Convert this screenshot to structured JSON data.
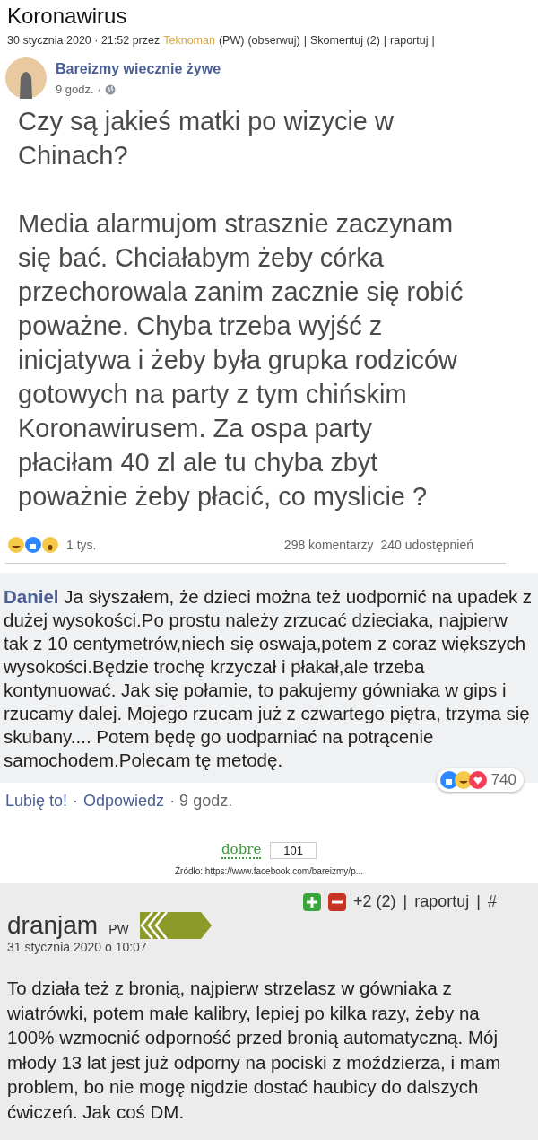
{
  "article": {
    "title": "Koronawirus",
    "date": "30 stycznia 2020 · 21:52 przez",
    "author": "Teknoman",
    "rank": "(PW)",
    "follow": "(obserwuj)",
    "sep1": "|",
    "comment_link": "Skomentuj (2)",
    "sep2": "|",
    "report": "raportuj",
    "sep3": "|"
  },
  "fb_post": {
    "page_name": "Bareizmy wiecznie żywe",
    "time": "9 godz. ·",
    "paragraphs": [
      "Czy są jakieś matki po wizycie w Chinach?",
      "Media alarmujom strasznie zaczynam się bać. Chciałabym żeby córka przechorowala zanim zacznie się robić poważne. Chyba trzeba wyjść z inicjatywa i żeby była grupka rodziców gotowych na party z tym chińskim Koronawirusem. Za ospa party płaciłam 40 zl ale tu chyba zbyt poważnie żeby płacić, co myslicie ?"
    ],
    "reactions_count": "1 tys.",
    "comments_count": "298 komentarzy",
    "shares_count": "240 udostępnień"
  },
  "fb_comment": {
    "author": "Daniel",
    "text": "Ja słyszałem, że dzieci można też uodpornić na upadek z dużej wysokości.Po prostu należy zrzucać dzieciaka, najpierw tak z 10 centymetrów,niech się oswaja,potem z coraz większych wysokości.Będzie trochę krzyczał i płakał,ale trzeba kontynuować. Jak się połamie, to pakujemy gówniaka w gips i rzucamy dalej. Mojego rzucam już z czwartego piętra, trzyma się skubany.... Potem będę go uodparniać na potrącenie samochodem.Polecam tę metodę.",
    "reactions_count": "740",
    "like": "Lubię to!",
    "reply": "Odpowiedz",
    "time": "· 9 godz.",
    "dot": "·"
  },
  "vote": {
    "label": "dobre",
    "count": "101"
  },
  "source": "Źródło: https://www.facebook.com/bareizmy/p...",
  "comment": {
    "score": "+2 (2)",
    "sep1": "|",
    "report": "raportuj",
    "sep2": "|",
    "anchor": "#",
    "author": "dranjam",
    "rank": "PW",
    "date": "31 stycznia 2020 o 10:07",
    "text": "To działa też z bronią, najpierw strzelasz w gówniaka z wiatrówki, potem małe kalibry, lepiej po kilka razy, żeby na 100% wzmocnić odporność przed bronią automatyczną. Mój młody 13 lat jest już odporny na pociski z moździerza, i mam problem, bo nie mogę nigdzie dostać haubicy do dalszych ćwiczeń. Jak coś DM."
  }
}
